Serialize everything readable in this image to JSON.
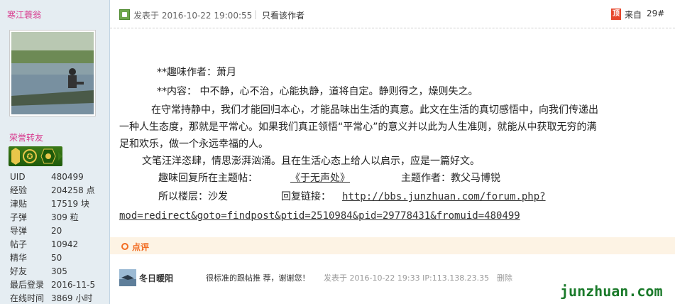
{
  "sidebar": {
    "username": "寒江蓑翁",
    "group": "荣誉转友",
    "stats": [
      {
        "label": "UID",
        "value": "480499"
      },
      {
        "label": "经验",
        "value": "204258 点"
      },
      {
        "label": "津贴",
        "value": "17519 块"
      },
      {
        "label": "子弹",
        "value": "309 粒"
      },
      {
        "label": "导弹",
        "value": "20"
      },
      {
        "label": "帖子",
        "value": "10942"
      },
      {
        "label": "精华",
        "value": "50"
      },
      {
        "label": "好友",
        "value": "305"
      },
      {
        "label": "最后登录",
        "value": "2016-11-5"
      },
      {
        "label": "在线时间",
        "value": "3869 小时"
      }
    ]
  },
  "post": {
    "posted_at": "发表于 2016-10-22 19:00:55",
    "separator": "|",
    "only_author": "只看该作者",
    "top_icon": "顶",
    "from": "来自",
    "floor": "29#",
    "lines": {
      "author": "**趣味作者：萧月",
      "content": "**内容：  中不静，心不治，心能执静，道将自定。静则得之，燥则失之。",
      "p1a": "在守常持静中，我们才能回归本心，才能品味出生活的真意。此文在生活的真切感悟中，向我们传递出",
      "p1b": "一种人生态度，那就是平常心。如果我们真正领悟“平常心”的意义并以此为人生准则，就能从中获取无穷的满",
      "p1c": "足和欢乐，做一个永远幸福的人。",
      "p2": "文笔汪洋恣肆，情思澎湃汹涌。且在生活心态上给人以启示，应是一篇好文。",
      "reply_topic_label": "趣味回复所在主题帖：",
      "reply_topic_link": "《于无声处》",
      "topic_author": "主题作者：教父马博锐",
      "floor_label": "所以楼层：沙发",
      "reply_link_label": "回复链接：",
      "reply_url_1": "http://bbs.junzhuan.com/forum.php?",
      "reply_url_2": "mod=redirect&goto=findpost&ptid=2510984&pid=29778431&fromuid=480499"
    }
  },
  "comments": {
    "title": "点评",
    "items": [
      {
        "name": "冬日暖阳",
        "text": "很标准的跟帖推 荐，谢谢您！",
        "meta": "发表于 2016-10-22 19:33 IP:113.138.23.35",
        "delete": "删除"
      }
    ]
  },
  "watermark": "junzhuan.com",
  "colors": {
    "sidebar_bg": "#e5edf2",
    "username": "#d83a8e",
    "comment_accent": "#f26c22",
    "watermark": "#1a7a2a"
  }
}
